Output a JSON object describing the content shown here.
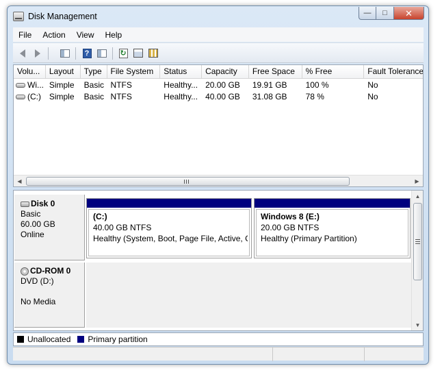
{
  "window": {
    "title": "Disk Management",
    "minimize": "—",
    "maximize": "□",
    "close": "✕"
  },
  "menu": [
    "File",
    "Action",
    "View",
    "Help"
  ],
  "toolbar": {
    "icons": [
      "back-arrow-icon",
      "forward-arrow-icon",
      "console-tree-icon",
      "help-icon",
      "show-action-pane-icon",
      "refresh-icon",
      "properties-icon",
      "settings-icon"
    ]
  },
  "volume_list": {
    "columns": [
      "Volu...",
      "Layout",
      "Type",
      "File System",
      "Status",
      "Capacity",
      "Free Space",
      "% Free",
      "Fault Tolerance"
    ],
    "rows": [
      [
        "Wi...",
        "Simple",
        "Basic",
        "NTFS",
        "Healthy...",
        "20.00 GB",
        "19.91 GB",
        "100 %",
        "No"
      ],
      [
        "(C:)",
        "Simple",
        "Basic",
        "NTFS",
        "Healthy...",
        "40.00 GB",
        "31.08 GB",
        "78 %",
        "No"
      ]
    ],
    "scroll_grip": "III"
  },
  "disks": [
    {
      "name": "Disk 0",
      "lines": [
        "Basic",
        "60.00 GB",
        "Online"
      ],
      "partitions": [
        {
          "name": "(C:)",
          "size": "40.00 GB NTFS",
          "status": "Healthy (System, Boot, Page File, Active, Cra"
        },
        {
          "name": "Windows 8  (E:)",
          "size": "20.00 GB NTFS",
          "status": "Healthy (Primary Partition)"
        }
      ]
    },
    {
      "name": "CD-ROM 0",
      "lines": [
        "DVD (D:)",
        "",
        "No Media"
      ]
    }
  ],
  "legend": [
    {
      "label": "Unallocated",
      "color": "#000000"
    },
    {
      "label": "Primary partition",
      "color": "#00007f"
    }
  ],
  "colors": {
    "partition_bar": "#00007f"
  }
}
